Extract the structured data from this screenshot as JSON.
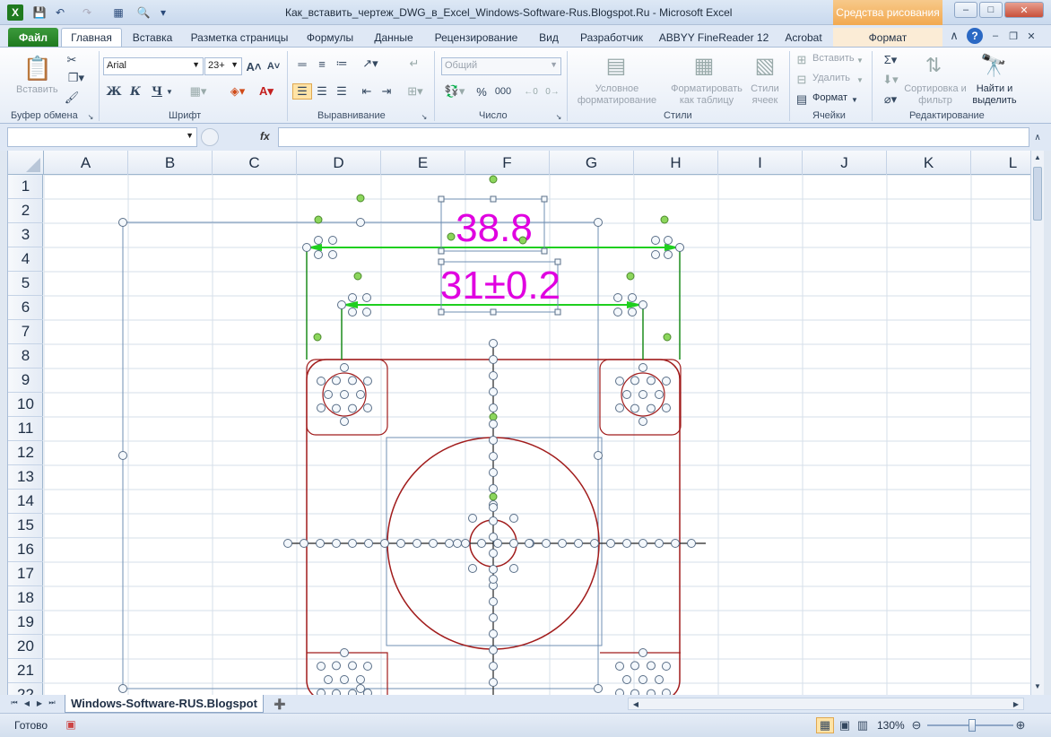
{
  "title_bar": {
    "title": "Как_вставить_чертеж_DWG_в_Excel_Windows-Software-Rus.Blogspot.Ru  -  Microsoft Excel",
    "contextual_tab": "Средства рисования"
  },
  "tabs": [
    "Файл",
    "Главная",
    "Вставка",
    "Разметка страницы",
    "Формулы",
    "Данные",
    "Рецензирование",
    "Вид",
    "Разработчик",
    "ABBYY FineReader 12",
    "Acrobat",
    "Формат"
  ],
  "ribbon": {
    "clipboard": {
      "paste": "Вставить",
      "label": "Буфер обмена"
    },
    "font": {
      "name": "Arial",
      "size": "23+",
      "bold": "Ж",
      "italic": "К",
      "underline": "Ч",
      "label": "Шрифт"
    },
    "alignment": {
      "label": "Выравнивание"
    },
    "number": {
      "format": "Общий",
      "percent": "%",
      "thousands": "000",
      "label": "Число"
    },
    "styles": {
      "conditional": "Условное форматирование",
      "as_table": "Форматировать как таблицу",
      "cell_styles": "Стили ячеек",
      "label": "Стили"
    },
    "cells": {
      "insert": "Вставить",
      "delete": "Удалить",
      "format": "Формат",
      "label": "Ячейки"
    },
    "editing": {
      "sort": "Сортировка и фильтр",
      "find": "Найти и выделить",
      "label": "Редактирование"
    }
  },
  "formula_bar": {
    "fx": "fx",
    "name_box": "",
    "formula": ""
  },
  "columns": [
    "A",
    "B",
    "C",
    "D",
    "E",
    "F",
    "G",
    "H",
    "I",
    "J",
    "K",
    "L"
  ],
  "rows": [
    "1",
    "2",
    "3",
    "4",
    "5",
    "6",
    "7",
    "8",
    "9",
    "10",
    "11",
    "12",
    "13",
    "14",
    "15",
    "16",
    "17",
    "18",
    "19",
    "20",
    "21",
    "22"
  ],
  "drawing": {
    "dim_top": "38.8",
    "dim_bottom": "31±0.2",
    "colors": {
      "dimension_text": "#e000e0",
      "dimension_line": "#1fcf1f",
      "outline": "#b01e1e",
      "handle": "#8cd65c"
    }
  },
  "sheet_tab": "Windows-Software-RUS.Blogspot",
  "status": {
    "ready": "Готово",
    "zoom": "130%"
  }
}
